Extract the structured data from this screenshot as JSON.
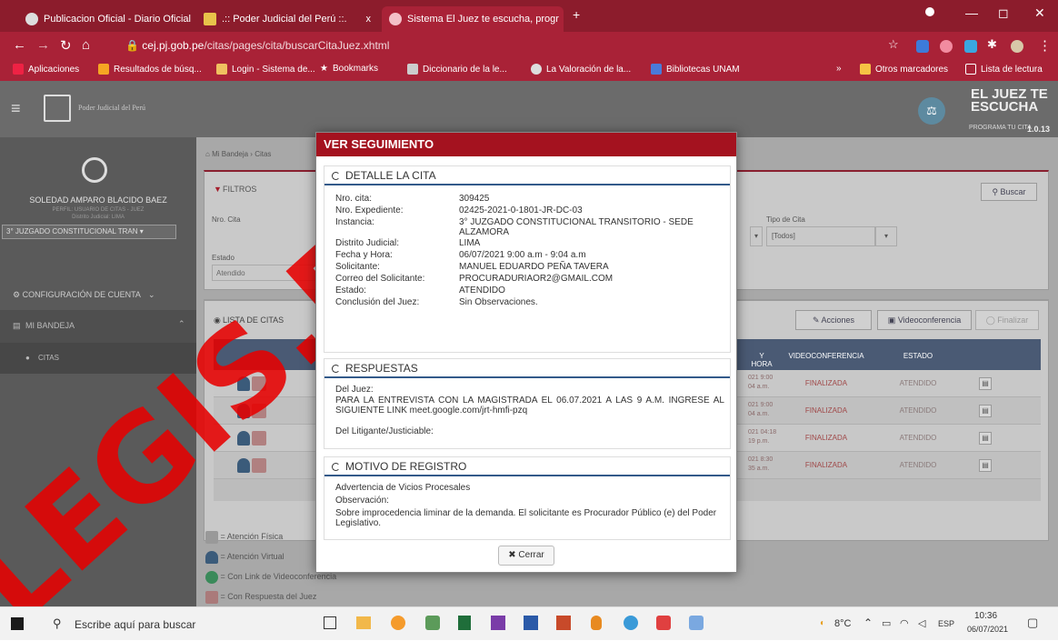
{
  "browser": {
    "tabs": [
      {
        "label": "Publicacion Oficial - Diario Oficial",
        "close": "x"
      },
      {
        "label": ".:: Poder Judicial del Perú ::.",
        "close": "x"
      },
      {
        "label": "Sistema El Juez te escucha, progr",
        "close": "x"
      }
    ],
    "new_tab": "+",
    "url_host": "cej.pj.gob.pe",
    "url_path": "/citas/pages/cita/buscarCitaJuez.xhtml",
    "bookmarks": [
      "Aplicaciones",
      "Resultados de búsq...",
      "Login - Sistema de...",
      "Bookmarks",
      "Diccionario de la le...",
      "La Valoración de la...",
      "Bibliotecas UNAM"
    ],
    "bookmarks_more": "»",
    "other_bookmarks": "Otros marcadores",
    "reading_list": "Lista de lectura"
  },
  "app": {
    "org_name": "Poder Judicial del Perú",
    "logo_title_1": "EL JUEZ TE",
    "logo_title_2": "ESCUCHA",
    "logo_subtitle": "PROGRAMA TU CITA",
    "version": "1.0.13"
  },
  "sidebar": {
    "user_name": "SOLEDAD AMPARO BLACIDO BAEZ",
    "profile": "PERFIL: USUARIO DE CITAS - JUEZ",
    "district": "Distrito Judicial: LIMA",
    "court_select": "3° JUZGADO CONSTITUCIONAL TRAN",
    "config": "CONFIGURACIÓN DE CUENTA",
    "bandeja": "MI BANDEJA",
    "citas": "CITAS"
  },
  "main": {
    "breadcrumb": "Mi Bandeja › Citas",
    "filters_title": "FILTROS",
    "search_btn": "Buscar",
    "nro_cita_label": "Nro. Cita",
    "tipo_label": "Tipo de Cita",
    "tipo_value": "[Todos]",
    "estado_label": "Estado",
    "estado_value": "Atendido",
    "list_title": "LISTA DE CITAS",
    "acciones": "Acciones",
    "videoconf": "Videoconferencia",
    "finalizar": "Finalizar",
    "col_fecha": "Y HORA",
    "col_video": "VIDEOCONFERENCIA",
    "col_estado": "ESTADO",
    "rows": [
      {
        "fecha": "021 9:00",
        "hora": "04 a.m.",
        "video": "FINALIZADA",
        "estado": "ATENDIDO"
      },
      {
        "fecha": "021 9:00",
        "hora": "04 a.m.",
        "video": "FINALIZADA",
        "estado": "ATENDIDO"
      },
      {
        "fecha": "021 04:18",
        "hora": "19 p.m.",
        "video": "FINALIZADA",
        "estado": "ATENDIDO"
      },
      {
        "fecha": "021 8:30",
        "hora": "35 a.m.",
        "video": "FINALIZADA",
        "estado": "ATENDIDO"
      }
    ],
    "legend": [
      "= Atención Física",
      "= Atención Virtual",
      "= Con Link de Videoconferencia",
      "= Con Respuesta del Juez"
    ]
  },
  "modal": {
    "title": "VER SEGUIMIENTO",
    "detail_title": "DETALLE LA CITA",
    "fields": [
      {
        "label": "Nro. cita:",
        "value": "309425"
      },
      {
        "label": "Nro. Expediente:",
        "value": "02425-2021-0-1801-JR-DC-03"
      },
      {
        "label": "Instancia:",
        "value": "3° JUZGADO CONSTITUCIONAL TRANSITORIO - SEDE ALZAMORA"
      },
      {
        "label": "Distrito Judicial:",
        "value": "LIMA"
      },
      {
        "label": "Fecha y Hora:",
        "value": "06/07/2021 9:00 a.m - 9:04 a.m"
      },
      {
        "label": "Solicitante:",
        "value": "MANUEL EDUARDO PEÑA TAVERA"
      },
      {
        "label": "Correo del Solicitante:",
        "value": "PROCURADURIAOR2@GMAIL.COM"
      },
      {
        "label": "Estado:",
        "value": "ATENDIDO"
      },
      {
        "label": "Conclusión del Juez:",
        "value": "Sin Observaciones."
      }
    ],
    "resp_title": "RESPUESTAS",
    "del_juez_label": "Del Juez:",
    "del_juez_text": "PARA LA ENTREVISTA CON LA MAGISTRADA EL 06.07.2021 A LAS 9 A.M. INGRESE AL SIGUIENTE LINK meet.google.com/jrt-hmfi-pzq",
    "del_litigante_label": "Del Litigante/Justiciable:",
    "motivo_title": "MOTIVO DE REGISTRO",
    "motivo_text": "Advertencia de Vicios Procesales",
    "obs_label": "Observación:",
    "obs_text": "Sobre improcedencia liminar de la demanda. El solicitante es Procurador Público (e) del Poder Legislativo.",
    "close_label": "Cerrar"
  },
  "watermark": "LEGIS.PE",
  "taskbar": {
    "search_placeholder": "Escribe aquí para buscar",
    "temp": "8°C",
    "lang": "ESP",
    "time": "10:36",
    "date": "06/07/2021"
  },
  "colors": {
    "brand": "#a92237",
    "header_red": "#a4121f",
    "watermark": "#e60000"
  }
}
